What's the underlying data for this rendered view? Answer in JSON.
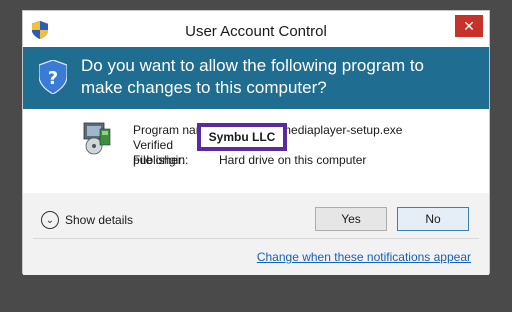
{
  "window": {
    "title": "User Account Control",
    "close_glyph": "✕"
  },
  "banner": {
    "question": "Do you want to allow the following program to make changes to this computer?"
  },
  "details": {
    "program_name_label": "Program name:",
    "program_name_value": "freeallinonemediaplayer-setup.exe",
    "publisher_label": "Verified publisher:",
    "publisher_value": "Symbu LLC",
    "origin_label": "File origin:",
    "origin_value": "Hard drive on this computer"
  },
  "footer": {
    "show_details_label": "Show details",
    "yes_label": "Yes",
    "no_label": "No",
    "notification_link": "Change when these notifications appear"
  },
  "colors": {
    "banner": "#1f6e91",
    "close": "#c7322a",
    "highlight_border": "#5b2aa0",
    "link": "#1560bd"
  },
  "icons": {
    "title_icon": "uac-shield-icon",
    "banner_icon": "uac-shield-icon",
    "program_icon": "installer-icon"
  }
}
